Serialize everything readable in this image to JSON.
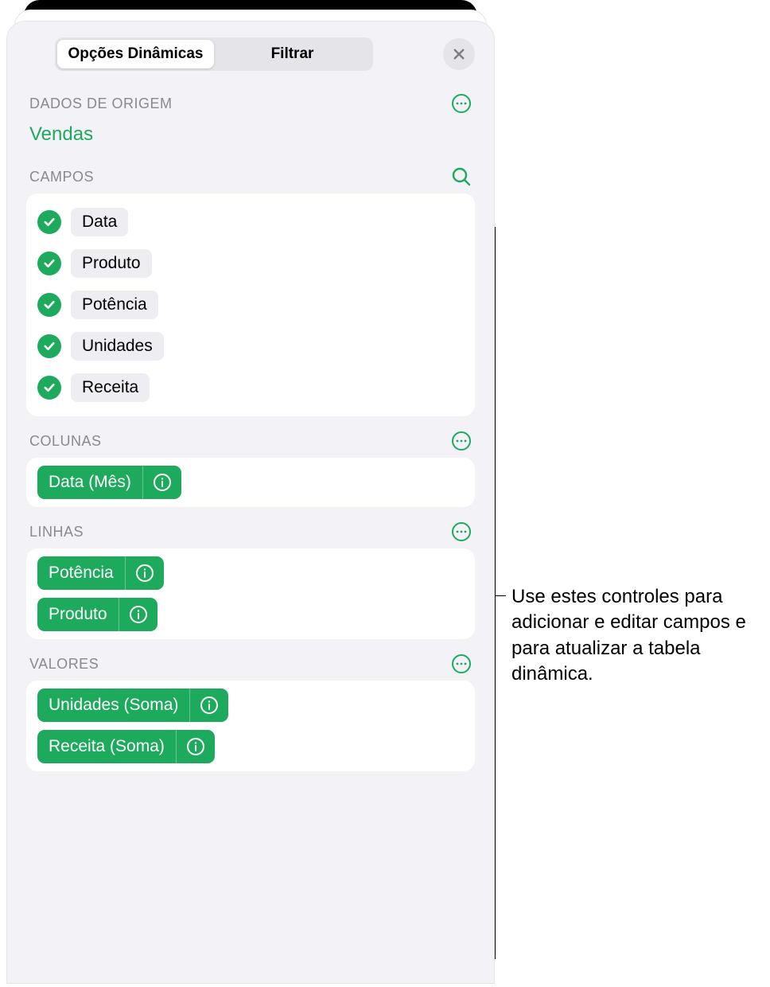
{
  "tabs": {
    "options": "Opções Dinâmicas",
    "filter": "Filtrar"
  },
  "sections": {
    "source": "DADOS DE ORIGEM",
    "fields": "CAMPOS",
    "columns": "COLUNAS",
    "rows": "LINHAS",
    "values": "VALORES"
  },
  "source_name": "Vendas",
  "fields": [
    {
      "label": "Data"
    },
    {
      "label": "Produto"
    },
    {
      "label": "Potência"
    },
    {
      "label": "Unidades"
    },
    {
      "label": "Receita"
    }
  ],
  "columns": [
    {
      "label": "Data (Mês)"
    }
  ],
  "rows": [
    {
      "label": "Potência"
    },
    {
      "label": "Produto"
    }
  ],
  "values": [
    {
      "label": "Unidades (Soma)"
    },
    {
      "label": "Receita (Soma)"
    }
  ],
  "callout": "Use estes controles para adicionar e editar campos e para atualizar a tabela dinâmica."
}
